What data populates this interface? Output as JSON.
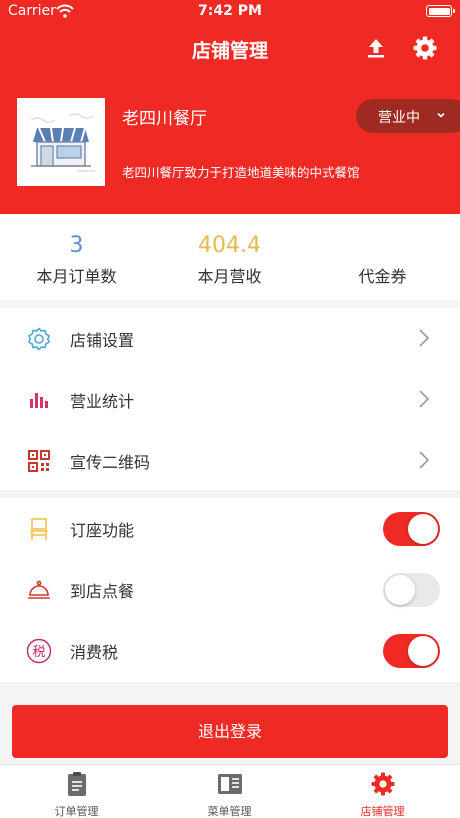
{
  "status_bar": {
    "carrier": "Carrier",
    "time": "7:42 PM"
  },
  "nav": {
    "title": "店铺管理"
  },
  "store": {
    "name": "老四川餐厅",
    "description": "老四川餐厅致力于打造地道美味的中式餐馆",
    "status": "营业中"
  },
  "stats": [
    {
      "value": "3",
      "label": "本月订单数",
      "color": "#5b8de0"
    },
    {
      "value": "404.4",
      "label": "本月营收",
      "color": "#e7b84e"
    },
    {
      "value": "",
      "label": "代金券",
      "color": "#333333"
    }
  ],
  "menu": [
    {
      "label": "店铺设置",
      "icon": "gear-outline-icon"
    },
    {
      "label": "营业统计",
      "icon": "bar-chart-icon"
    },
    {
      "label": "宣传二维码",
      "icon": "qr-code-icon"
    }
  ],
  "toggles": [
    {
      "label": "订座功能",
      "icon": "chair-icon",
      "on": true
    },
    {
      "label": "到店点餐",
      "icon": "food-cloche-icon",
      "on": false
    },
    {
      "label": "消费税",
      "icon": "tax-icon",
      "icon_text": "税",
      "on": true
    }
  ],
  "logout_label": "退出登录",
  "tabs": [
    {
      "label": "订单管理",
      "icon": "clipboard-icon",
      "active": false
    },
    {
      "label": "菜单管理",
      "icon": "menu-book-icon",
      "active": false
    },
    {
      "label": "店铺管理",
      "icon": "store-gear-icon",
      "active": true
    }
  ],
  "colors": {
    "primary": "#ef2a24",
    "dropdown_bg": "#9e2a22",
    "page_bg": "#f4f4f4"
  }
}
